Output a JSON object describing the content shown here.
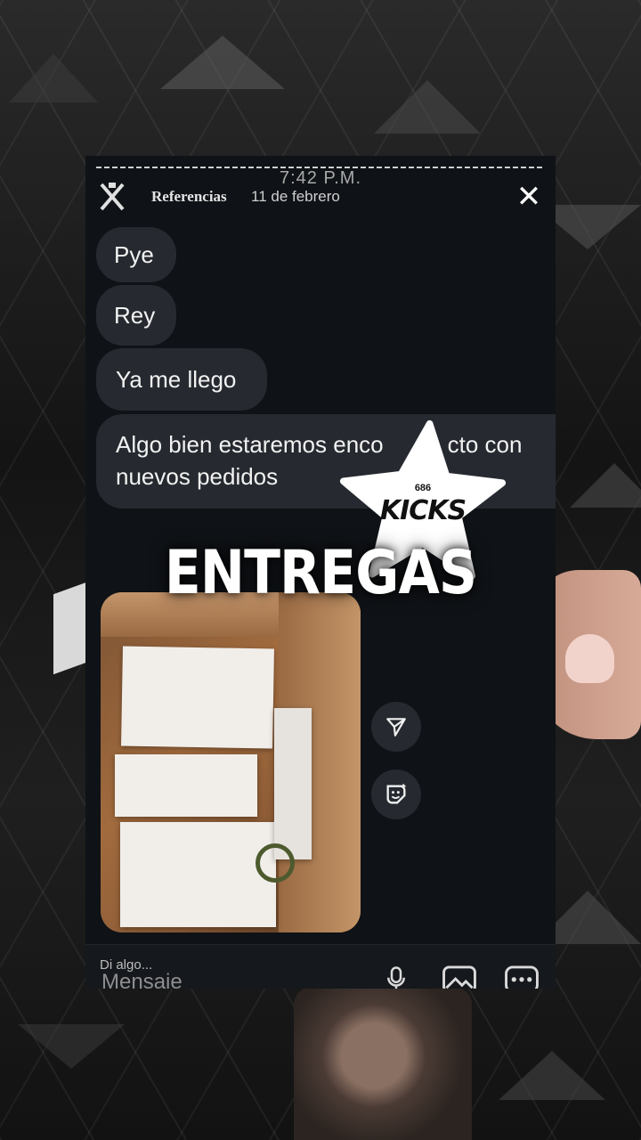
{
  "story": {
    "time": "7:42 P.M.",
    "account": "Referencias",
    "date": "11 de febrero",
    "close_glyph": "✕"
  },
  "messages": [
    "Pye",
    "Rey",
    "Ya me llego",
    "Algo bien estaremos enco",
    "cto con",
    "nuevos pedidos"
  ],
  "overlay": {
    "headline": "ENTREGAS",
    "sticker_number": "686",
    "sticker_text": "KICKS"
  },
  "composer": {
    "hint": "Di algo...",
    "placeholder": "Mensaje"
  },
  "icons": [
    "close-icon",
    "send-icon",
    "sticker-icon",
    "mic-icon",
    "gallery-icon",
    "more-icon",
    "avatar-logo"
  ],
  "colors": {
    "bubble": "#262a30",
    "panel": "#0f1216",
    "headline": "#ffffff"
  }
}
